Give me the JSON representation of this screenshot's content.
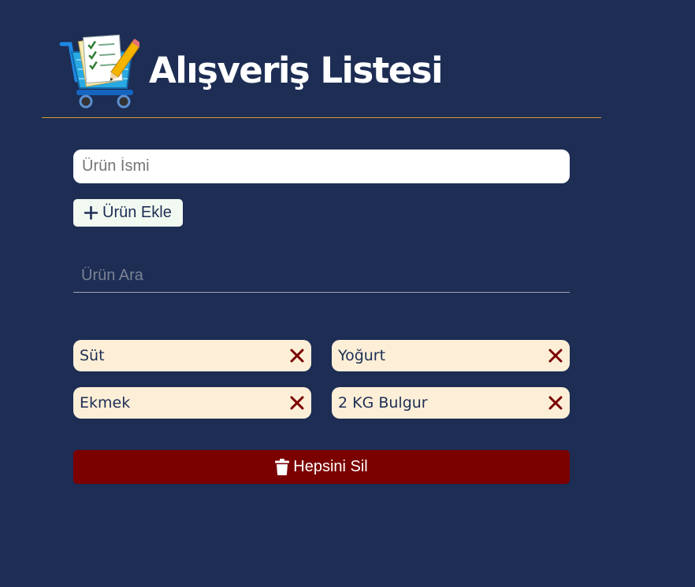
{
  "header": {
    "title": "Alışveriş Listesi",
    "logo_icon": "shopping-cart-checklist-icon"
  },
  "form": {
    "name_placeholder": "Ürün İsmi",
    "name_value": "",
    "add_label": "Ürün Ekle",
    "add_icon": "plus-icon"
  },
  "search": {
    "placeholder": "Ürün Ara",
    "value": ""
  },
  "items": [
    {
      "label": "Süt"
    },
    {
      "label": "Yoğurt"
    },
    {
      "label": "Ekmek"
    },
    {
      "label": "2 KG Bulgur"
    }
  ],
  "clear": {
    "label": "Hepsini Sil",
    "icon": "trash-icon"
  },
  "colors": {
    "background": "#1d2d54",
    "accent_line": "#d79a2b",
    "item_bg": "#fdefd7",
    "delete_red": "#7b0000",
    "add_button_bg": "#f1f9f1"
  }
}
